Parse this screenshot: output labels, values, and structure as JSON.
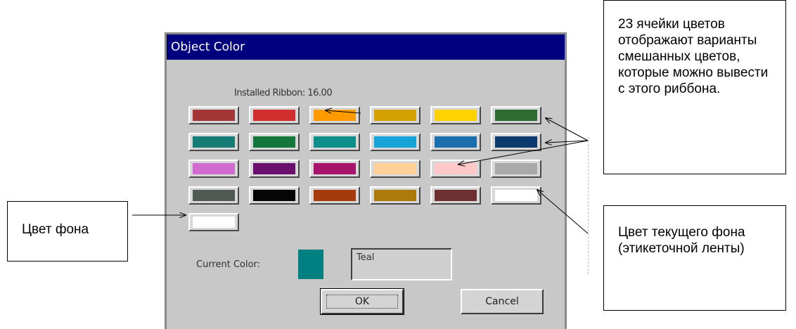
{
  "dialog": {
    "title": "Object Color",
    "ribbon_label": "Installed Ribbon:  16.00",
    "swatch_colors": [
      "#a33737",
      "#d12f2f",
      "#ff9a00",
      "#d3a100",
      "#ffd100",
      "#2e6c33",
      "#157b75",
      "#14763b",
      "#0f8f8c",
      "#17a2d8",
      "#1b6fae",
      "#0c3a6f",
      "#d16bd0",
      "#6a0f6e",
      "#a8136b",
      "#ffd199",
      "#ffc9c9",
      "#a9a9a9",
      "#505a52",
      "#050505",
      "#a53b0c",
      "#ab7a0a",
      "#6d3030",
      "#ffffff",
      "#ffffff"
    ],
    "current_color_label": "Current Color:",
    "current_color": "#008080",
    "current_color_name": "Teal",
    "ok_label": "OK",
    "cancel_label": "Cancel"
  },
  "callouts": {
    "top_text": "23 ячейки цветов отображают варианты смешанных цветов, которые можно вывести с этого риббона.",
    "bottom_text": "Цвет текущего фона (этикеточной ленты)",
    "left_text": "Цвет фона"
  }
}
